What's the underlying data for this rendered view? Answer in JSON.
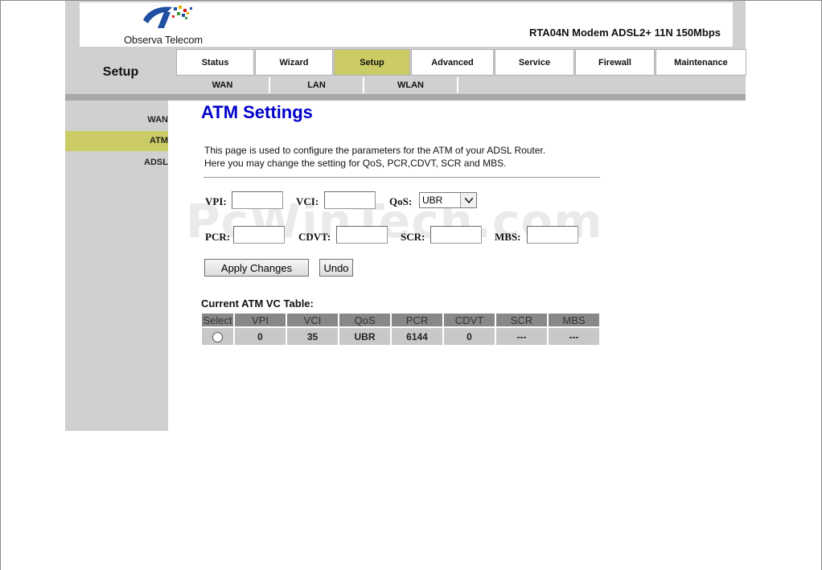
{
  "header": {
    "brand": "Observa Telecom",
    "model": "RTA04N Modem ADSL2+ 11N 150Mbps"
  },
  "section_title": "Setup",
  "nav": {
    "tabs": [
      {
        "label": "Status",
        "active": false
      },
      {
        "label": "Wizard",
        "active": false
      },
      {
        "label": "Setup",
        "active": true
      },
      {
        "label": "Advanced",
        "active": false
      },
      {
        "label": "Service",
        "active": false
      },
      {
        "label": "Firewall",
        "active": false
      },
      {
        "label": "Maintenance",
        "active": false
      }
    ],
    "subtabs": [
      "WAN",
      "LAN",
      "WLAN"
    ]
  },
  "sidebar": {
    "items": [
      {
        "label": "WAN",
        "active": false
      },
      {
        "label": "ATM",
        "active": true
      },
      {
        "label": "ADSL",
        "active": false
      }
    ]
  },
  "main": {
    "title": "ATM Settings",
    "description_line1": "This page is used to configure the parameters for the ATM of your ADSL Router.",
    "description_line2": "Here you may change the setting for QoS, PCR,CDVT, SCR and MBS.",
    "form": {
      "vpi_label": "VPI:",
      "vpi_value": "",
      "vci_label": "VCI:",
      "vci_value": "",
      "qos_label": "QoS:",
      "qos_value": "UBR",
      "pcr_label": "PCR:",
      "pcr_value": "",
      "cdvt_label": "CDVT:",
      "cdvt_value": "",
      "scr_label": "SCR:",
      "scr_value": "",
      "mbs_label": "MBS:",
      "mbs_value": ""
    },
    "buttons": {
      "apply": "Apply Changes",
      "undo": "Undo"
    },
    "table": {
      "title": "Current ATM VC Table:",
      "headers": [
        "Select",
        "VPI",
        "VCI",
        "QoS",
        "PCR",
        "CDVT",
        "SCR",
        "MBS"
      ],
      "rows": [
        {
          "vpi": "0",
          "vci": "35",
          "qos": "UBR",
          "pcr": "6144",
          "cdvt": "0",
          "scr": "---",
          "mbs": "---"
        }
      ]
    }
  },
  "watermark": "PcWinTech.com",
  "colors": {
    "accent": "#cccc66",
    "title": "#0000cc",
    "frame": "#d0d0d0",
    "table_header": "#888888",
    "table_cell": "#c8c8c8"
  }
}
